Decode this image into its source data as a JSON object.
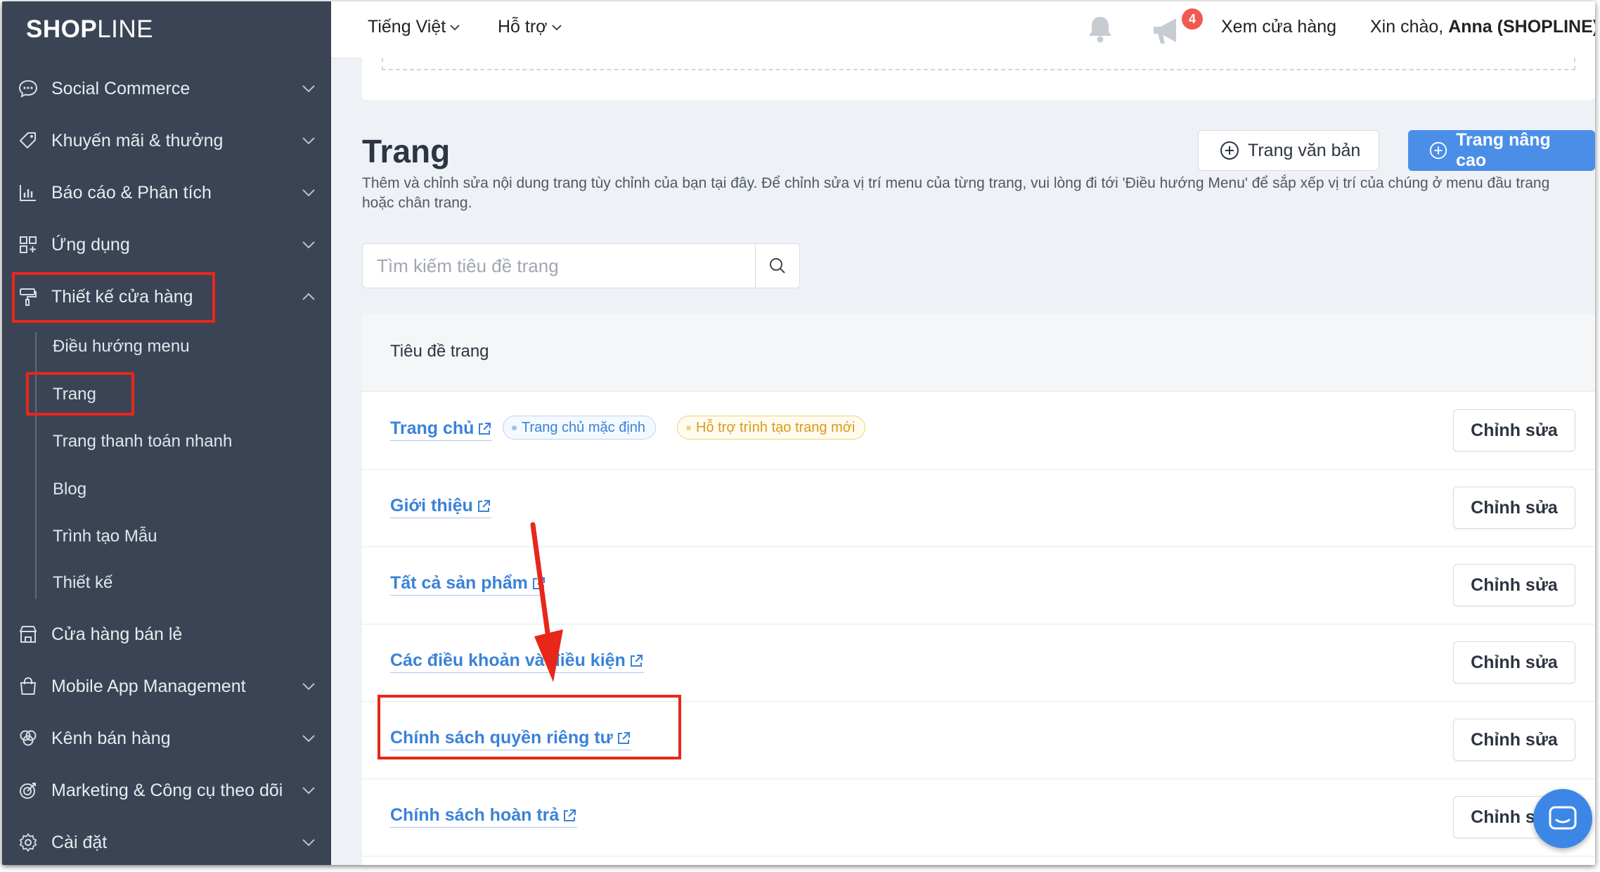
{
  "brand": {
    "logo_bold": "SHOP",
    "logo_light": "LINE"
  },
  "sidebar": {
    "items": [
      {
        "label": "Social Commerce",
        "icon": "chat-icon",
        "expandable": true
      },
      {
        "label": "Khuyến mãi & thưởng",
        "icon": "tag-icon",
        "expandable": true
      },
      {
        "label": "Báo cáo & Phân tích",
        "icon": "chart-icon",
        "expandable": true
      },
      {
        "label": "Ứng dụng",
        "icon": "apps-icon",
        "expandable": true
      },
      {
        "label": "Thiết kế cửa hàng",
        "icon": "paint-roller-icon",
        "expanded": true
      },
      {
        "label": "Cửa hàng bán lẻ",
        "icon": "store-icon",
        "expandable": false
      },
      {
        "label": "Mobile App Management",
        "icon": "bag-icon",
        "expandable": true
      },
      {
        "label": "Kênh bán hàng",
        "icon": "channels-icon",
        "expandable": true
      },
      {
        "label": "Marketing & Công cụ theo dõi",
        "icon": "target-icon",
        "expandable": true
      },
      {
        "label": "Cài đặt",
        "icon": "gear-icon",
        "expandable": true
      }
    ],
    "subitems": [
      "Điều hướng menu",
      "Trang",
      "Trang thanh toán nhanh",
      "Blog",
      "Trình tạo Mẫu",
      "Thiết kế"
    ]
  },
  "topbar": {
    "language": "Tiếng Việt",
    "support": "Hỗ trợ",
    "notification_count": "4",
    "view_store": "Xem cửa hàng",
    "greeting": "Xin chào,",
    "user": "Anna (SHOPLINE)"
  },
  "page": {
    "title": "Trang",
    "description": "Thêm và chỉnh sửa nội dung trang tùy chỉnh của bạn tại đây. Để chỉnh sửa vị trí menu của từng trang, vui lòng đi tới 'Điều hướng Menu' để sắp xếp vị trí của chúng ở menu đầu trang hoặc chân trang.",
    "btn_text_page": "Trang văn bản",
    "btn_advanced_page": "Trang nâng cao",
    "search_placeholder": "Tìm kiếm tiêu đề trang"
  },
  "table": {
    "header": "Tiêu đề trang",
    "edit_label": "Chỉnh sửa",
    "rows": [
      {
        "title": "Trang chủ",
        "tags": [
          "Trang chủ mặc định",
          "Hỗ trợ trình tạo trang mới"
        ]
      },
      {
        "title": "Giới thiệu"
      },
      {
        "title": "Tất cả sản phẩm"
      },
      {
        "title": "Các điều khoản và điều kiện"
      },
      {
        "title": "Chính sách quyền riêng tư"
      },
      {
        "title": "Chính sách hoàn trả"
      }
    ]
  },
  "colors": {
    "sidebar_bg": "#3a4454",
    "primary": "#4a8ee8",
    "link": "#3a82d8",
    "annotation": "#e8271b"
  }
}
